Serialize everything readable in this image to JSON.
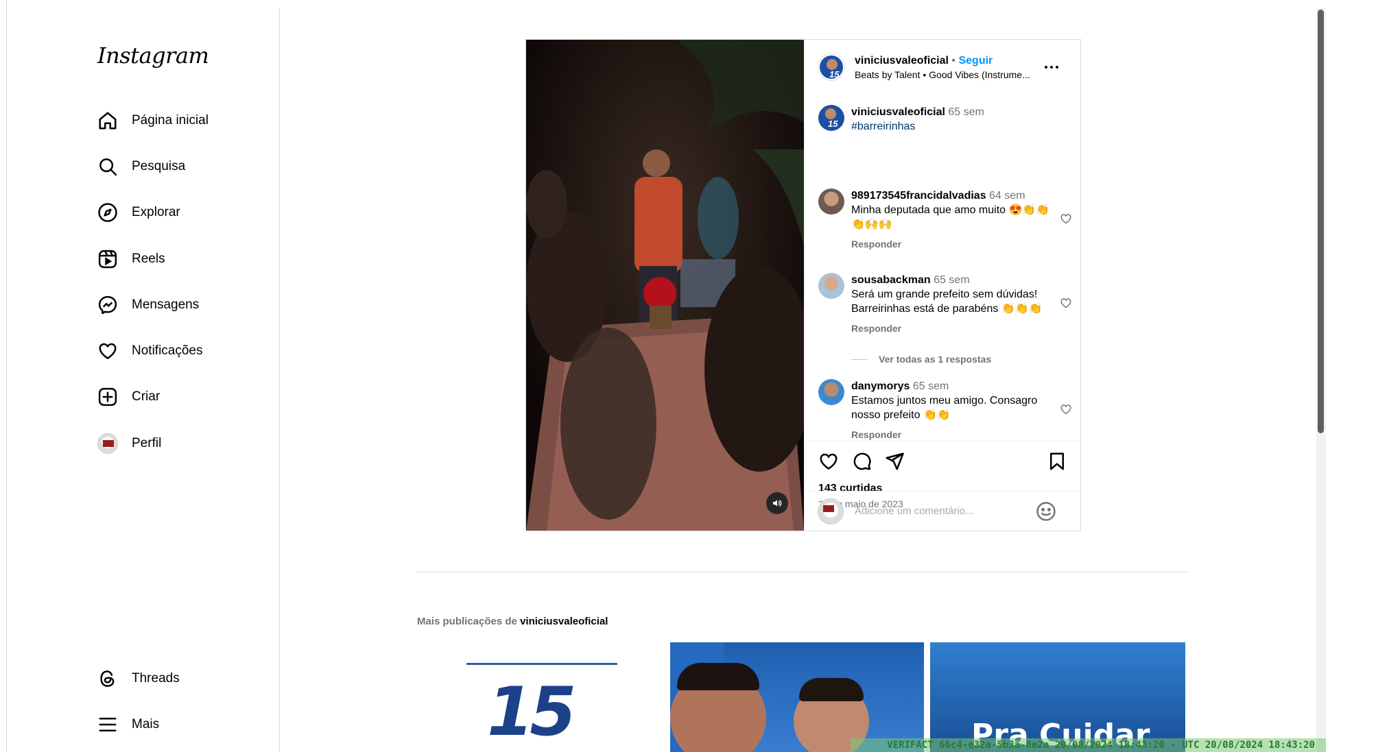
{
  "app": {
    "logo_text": "Instagram"
  },
  "sidebar": {
    "items": [
      {
        "label": "Página inicial",
        "icon": "home-icon"
      },
      {
        "label": "Pesquisa",
        "icon": "search-icon"
      },
      {
        "label": "Explorar",
        "icon": "compass-icon"
      },
      {
        "label": "Reels",
        "icon": "reels-icon"
      },
      {
        "label": "Mensagens",
        "icon": "messenger-icon"
      },
      {
        "label": "Notificações",
        "icon": "heart-icon"
      },
      {
        "label": "Criar",
        "icon": "plus-square-icon"
      },
      {
        "label": "Perfil",
        "icon": "profile-avatar"
      }
    ],
    "bottom": [
      {
        "label": "Threads",
        "icon": "threads-icon"
      },
      {
        "label": "Mais",
        "icon": "menu-icon"
      }
    ]
  },
  "post": {
    "username": "viniciusvaleoficial",
    "separator": "•",
    "follow_label": "Seguir",
    "audio": "Beats by Talent • Good Vibes (Instrume...",
    "caption": {
      "user": "viniciusvaleoficial",
      "time": "65 sem",
      "text": "#barreirinhas"
    },
    "comments": [
      {
        "user": "989173545francidalvadias",
        "time": "64 sem",
        "text": "Minha deputada que amo muito 😍👏👏👏🙌🙌",
        "reply": "Responder"
      },
      {
        "user": "sousabackman",
        "time": "65 sem",
        "text": "Será um grande prefeito sem dúvidas! Barreirinhas está de parabéns 👏👏👏",
        "reply": "Responder"
      },
      {
        "user": "danymorys",
        "time": "65 sem",
        "text": "Estamos juntos meu amigo. Consagro nosso prefeito 👏👏",
        "reply": "Responder"
      }
    ],
    "view_replies": "Ver todas as 1 respostas",
    "likes": "143 curtidas",
    "date": "21 de maio de 2023",
    "comment_placeholder": "Adicione um comentário..."
  },
  "more_posts": {
    "prefix": "Mais publicações de ",
    "username": "viniciusvaleoficial",
    "thumb1_text": "15",
    "thumb3_text": "Pra Cuidar"
  },
  "watermark": "VERIFACT 66c4-e32a-5b3a-8e2a  20/08/2024 18:43:20 - UTC 20/08/2024 18:43:20",
  "colors": {
    "link": "#0095f6",
    "hashtag": "#00376b",
    "muted": "#737373",
    "border": "#dbdbdb"
  }
}
